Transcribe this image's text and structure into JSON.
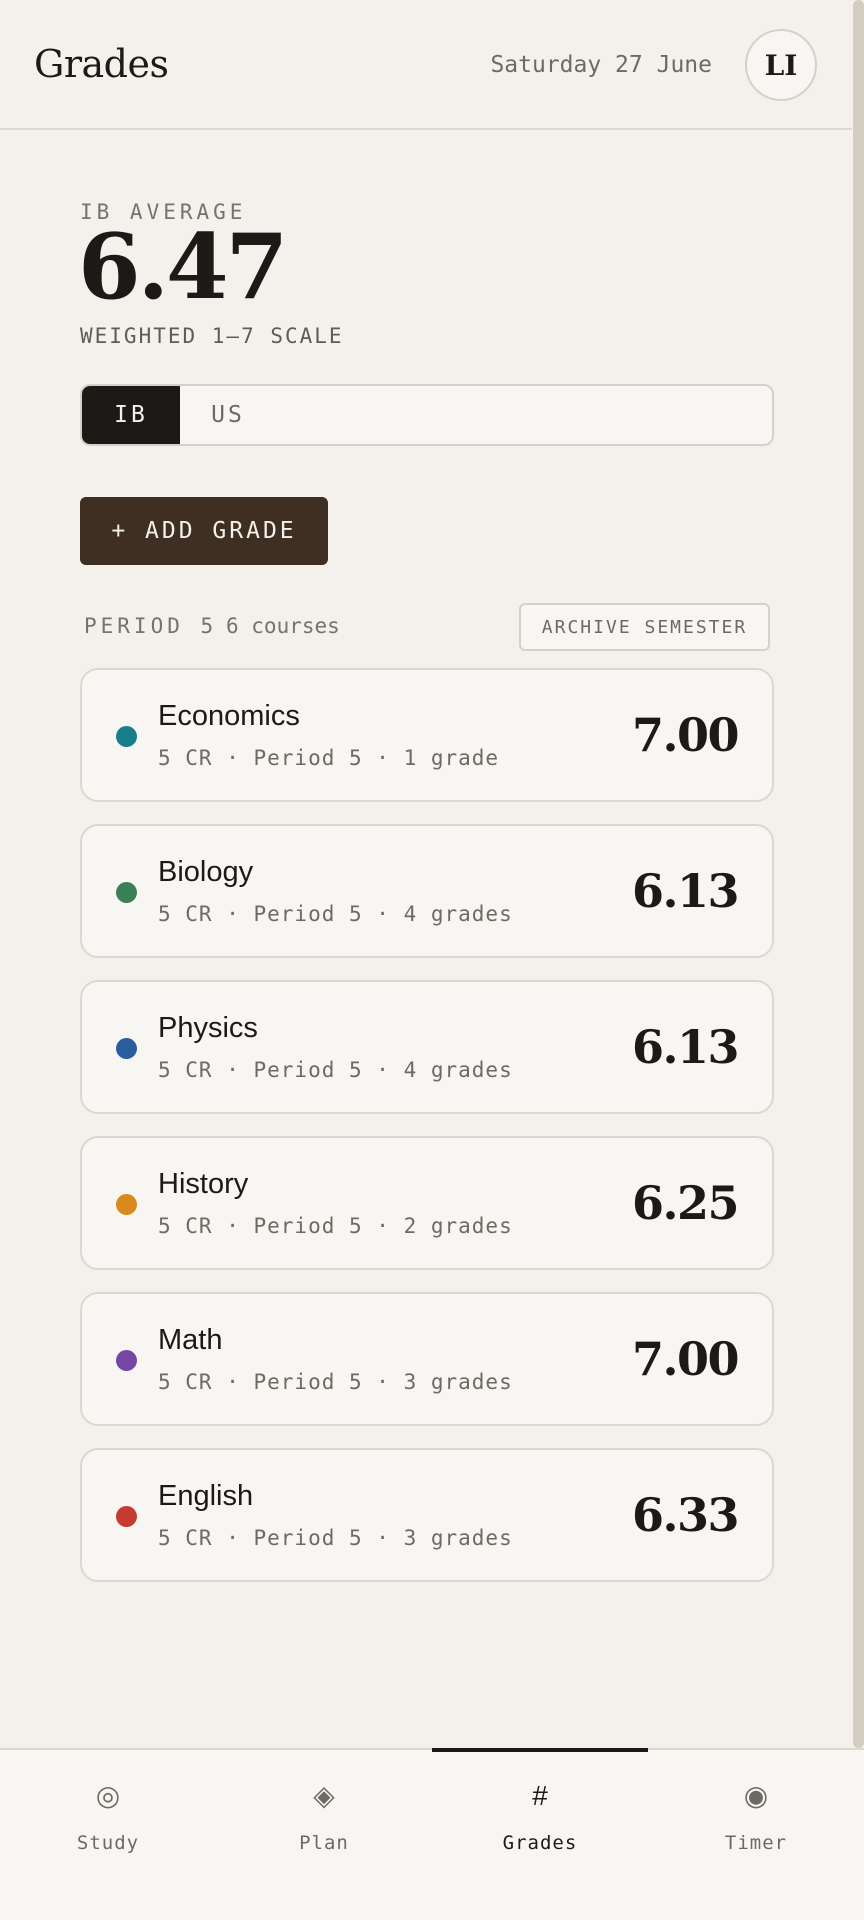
{
  "header": {
    "title": "Grades",
    "date": "Saturday 27 June",
    "avatar_initials": "LI"
  },
  "summary": {
    "label": "IB AVERAGE",
    "value": "6.47",
    "subtitle": "WEIGHTED 1–7 SCALE"
  },
  "scale_toggle": {
    "options": [
      "IB",
      "US"
    ],
    "selected": "IB"
  },
  "actions": {
    "add_grade": "+ ADD GRADE",
    "archive": "ARCHIVE SEMESTER"
  },
  "period": {
    "label": "PERIOD 5",
    "count": "6 courses"
  },
  "courses": [
    {
      "name": "Economics",
      "meta": "5 CR · Period 5 · 1 grade",
      "grade": "7.00",
      "color": "#1a7e8a"
    },
    {
      "name": "Biology",
      "meta": "5 CR · Period 5 · 4 grades",
      "grade": "6.13",
      "color": "#3a7f55"
    },
    {
      "name": "Physics",
      "meta": "5 CR · Period 5 · 4 grades",
      "grade": "6.13",
      "color": "#2a5d9c"
    },
    {
      "name": "History",
      "meta": "5 CR · Period 5 · 2 grades",
      "grade": "6.25",
      "color": "#d88a1c"
    },
    {
      "name": "Math",
      "meta": "5 CR · Period 5 · 3 grades",
      "grade": "7.00",
      "color": "#7646a6"
    },
    {
      "name": "English",
      "meta": "5 CR · Period 5 · 3 grades",
      "grade": "6.33",
      "color": "#c53b31"
    }
  ],
  "nav": {
    "items": [
      {
        "label": "Study",
        "icon": "target-icon",
        "glyph": "◎"
      },
      {
        "label": "Plan",
        "icon": "diamond-icon",
        "glyph": "◈"
      },
      {
        "label": "Grades",
        "icon": "hash-icon",
        "glyph": "#"
      },
      {
        "label": "Timer",
        "icon": "dot-circle-icon",
        "glyph": "◉"
      }
    ],
    "active": "Grades"
  }
}
